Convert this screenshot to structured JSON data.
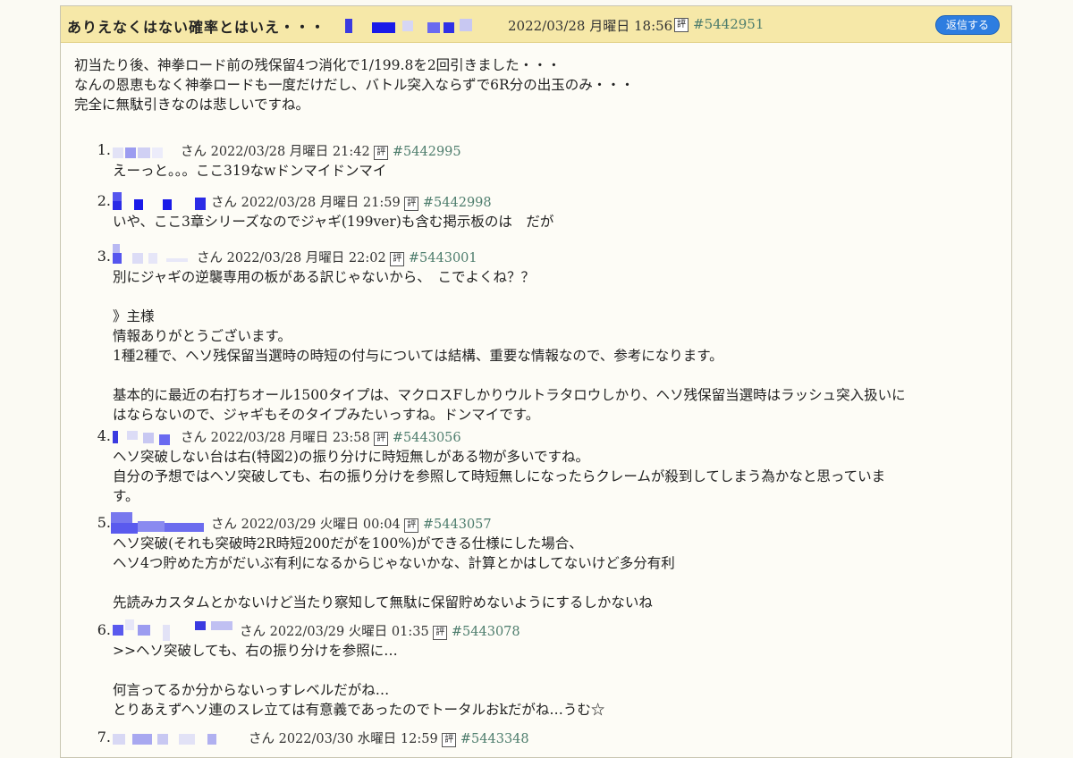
{
  "thread": {
    "title": "ありえなくはない確率とはいえ・・・",
    "date": "2022/03/28 月曜日 18:56",
    "rating_label": "評",
    "id": "#5442951",
    "reply_button": "返信する",
    "body": "初当たり後、神拳ロード前の残保留4つ消化で1/199.8を2回引きました・・・\nなんの恩恵もなく神拳ロードも一度だけだし、バトル突入ならずで6R分の出玉のみ・・・\n完全に無駄引きなのは悲しいですね。"
  },
  "replies": [
    {
      "num": "1.",
      "san": "さん",
      "date": "2022/03/28 月曜日 21:42",
      "rating_label": "評",
      "id": "#5442995",
      "text": "えーっと。。。ここ319なwドンマイドンマイ"
    },
    {
      "num": "2.",
      "san": "さん",
      "date": "2022/03/28 月曜日 21:59",
      "rating_label": "評",
      "id": "#5442998",
      "text": "いや、ここ3章シリーズなのでジャギ(199ver)も含む掲示板のは　だが"
    },
    {
      "num": "3.",
      "san": "さん",
      "date": "2022/03/28 月曜日 22:02",
      "rating_label": "評",
      "id": "#5443001",
      "text": "別にジャギの逆襲専用の板がある訳じゃないから、　こでよくね？？\n\n》主様\n情報ありがとうございます。\n1種2種で、ヘソ残保留当選時の時短の付与については結構、重要な情報なので、参考になります。\n\n基本的に最近の右打ちオール1500タイプは、マクロスFしかりウルトラタロウしかり、ヘソ残保留当選時はラッシュ突入扱いに\nはならないので、ジャギもそのタイプみたいっすね。ドンマイです。"
    },
    {
      "num": "4.",
      "san": "さん",
      "date": "2022/03/28 月曜日 23:58",
      "rating_label": "評",
      "id": "#5443056",
      "text": "ヘソ突破しない台は右(特図2)の振り分けに時短無しがある物が多いですね。\n自分の予想ではヘソ突破しても、右の振り分けを参照して時短無しになったらクレームが殺到してしまう為かなと思っていま\nす。"
    },
    {
      "num": "5.",
      "san": "さん",
      "date": "2022/03/29 火曜日 00:04",
      "rating_label": "評",
      "id": "#5443057",
      "text": "ヘソ突破(それも突破時2R時短200だがを100%)ができる仕様にした場合、\nヘソ4つ貯めた方がだいぶ有利になるからじゃないかな、計算とかはしてないけど多分有利\n\n先読みカスタムとかないけど当たり察知して無駄に保留貯めないようにするしかないね"
    },
    {
      "num": "6.",
      "san": "さん",
      "date": "2022/03/29 火曜日 01:35",
      "rating_label": "評",
      "id": "#5443078",
      "text": ">>ヘソ突破しても、右の振り分けを参照に…\n\n何言ってるか分からないっすレベルだがね…\nとりあえずヘソ連のスレ立ては有意義であったのでトータルおkだがね…うむ☆"
    },
    {
      "num": "7.",
      "san": "さん",
      "date": "2022/03/30 水曜日 12:59",
      "rating_label": "評",
      "id": "#5443348",
      "text": ""
    }
  ]
}
